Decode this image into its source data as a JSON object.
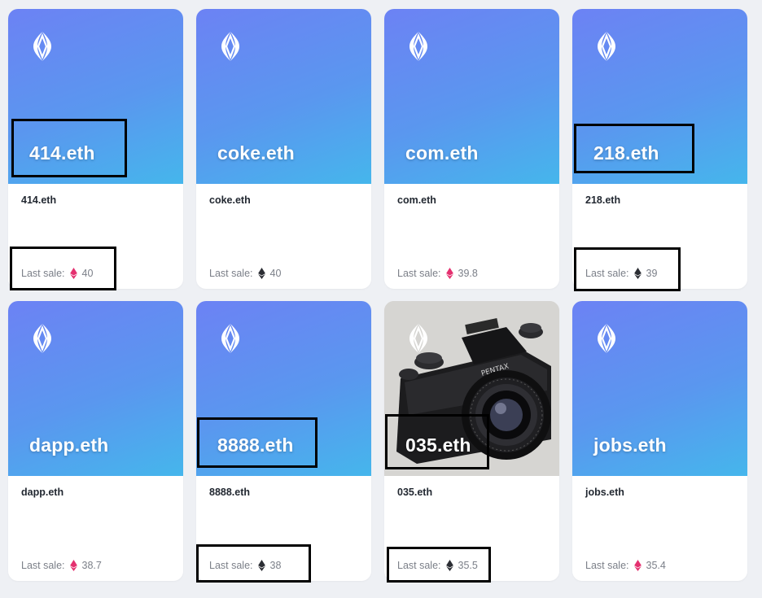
{
  "sale_label": "Last sale:",
  "colors": {
    "gradient_top": "#6c82f4",
    "gradient_bottom": "#45b6ec",
    "eth_pink": "#e4306f",
    "eth_dark": "#2b2d33"
  },
  "cards": [
    {
      "banner_title": "414.eth",
      "name": "414.eth",
      "price": "40",
      "eth_icon": "pink"
    },
    {
      "banner_title": "coke.eth",
      "name": "coke.eth",
      "price": "40",
      "eth_icon": "dark"
    },
    {
      "banner_title": "com.eth",
      "name": "com.eth",
      "price": "39.8",
      "eth_icon": "pink"
    },
    {
      "banner_title": "218.eth",
      "name": "218.eth",
      "price": "39",
      "eth_icon": "dark"
    },
    {
      "banner_title": "dapp.eth",
      "name": "dapp.eth",
      "price": "38.7",
      "eth_icon": "pink"
    },
    {
      "banner_title": "8888.eth",
      "name": "8888.eth",
      "price": "38",
      "eth_icon": "dark"
    },
    {
      "banner_title": "035.eth",
      "name": "035.eth",
      "price": "35.5",
      "eth_icon": "dark",
      "image": "camera-photo"
    },
    {
      "banner_title": "jobs.eth",
      "name": "jobs.eth",
      "price": "35.4",
      "eth_icon": "pink"
    }
  ]
}
